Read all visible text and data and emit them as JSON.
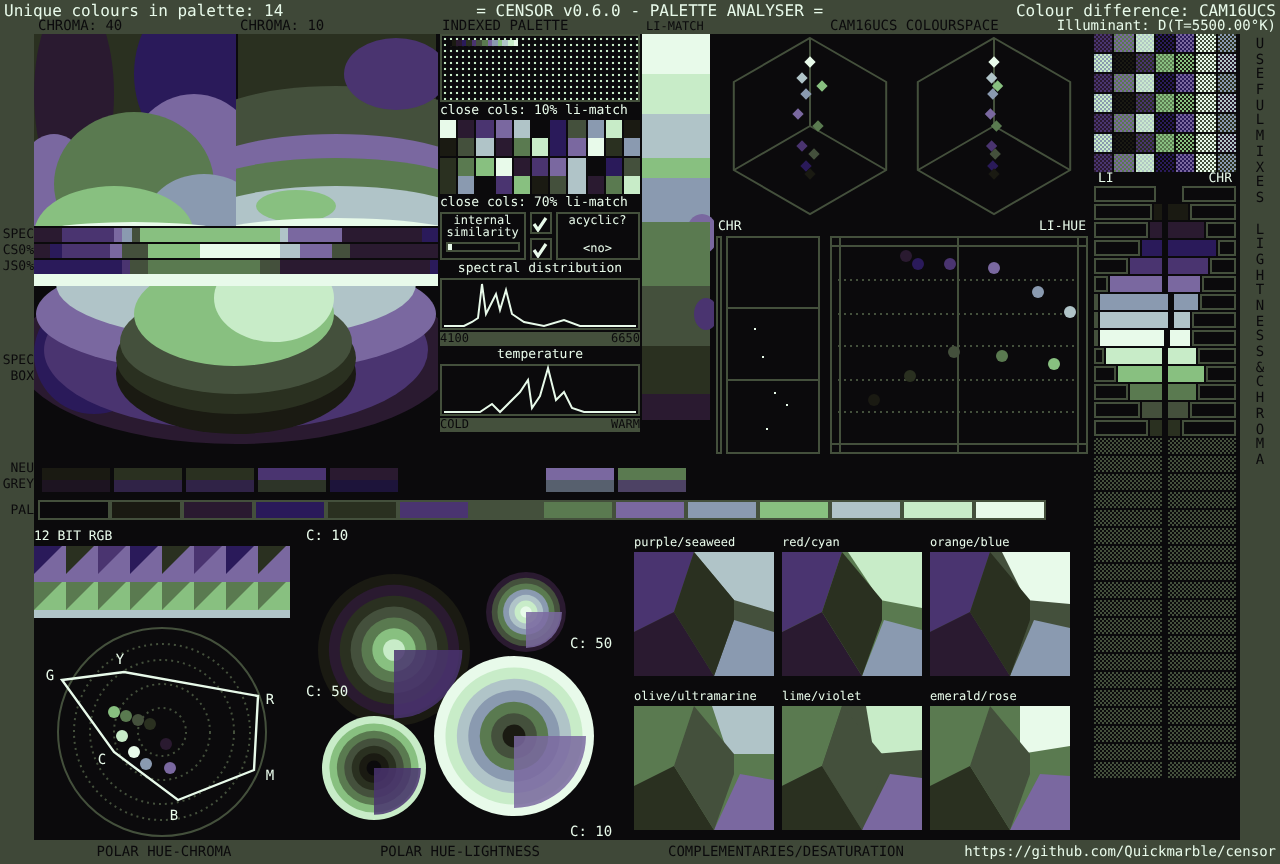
{
  "header": {
    "unique_colours": "Unique colours in palette: 14",
    "title": "= CENSOR v0.6.0 - PALETTE ANALYSER =",
    "colour_difference": "Colour difference: CAM16UCS",
    "illuminant": "Illuminant: D(T=5500.00°K)"
  },
  "panel_labels": {
    "chroma_40": "CHROMA: 40",
    "chroma_10": "CHROMA: 10",
    "indexed_palette": "INDEXED PALETTE",
    "li_match": "LI-MATCH",
    "colourspace": "CAM16UCS COLOURSPACE"
  },
  "side_labels": {
    "strips": [
      "SPEC",
      "CS0%",
      "JS0%"
    ],
    "spec_box": "SPEC BOX",
    "neutral_grey": "NEU GREY",
    "palette": "PAL"
  },
  "close_colours": [
    "close cols: 10% li-match",
    "close cols: 70% li-match"
  ],
  "internal_similarity": {
    "label": "internal similarity",
    "checked": true,
    "level": 0.05
  },
  "acyclic": {
    "label": "acyclic?",
    "checked": true,
    "value": "<no>"
  },
  "spectral": {
    "title": "spectral distribution",
    "min": "4100",
    "max": "6650"
  },
  "temperature": {
    "title": "temperature",
    "min": "COLD",
    "max": "WARM"
  },
  "li_hue": {
    "chr_label": "CHR",
    "title": "LI-HUE"
  },
  "bars": {
    "li_label": "LI",
    "chr_label": "CHR"
  },
  "side_titles": [
    "USEFUL MIXES",
    "LIGHTNESS & CHROMA"
  ],
  "rgb_label": "12 BIT RGB",
  "polar_chroma_hues": [
    "G",
    "Y",
    "R",
    "C",
    "M",
    "B"
  ],
  "polar_lightness": [
    "C: 10",
    "C: 50",
    "C: 50",
    "C: 10"
  ],
  "complementaries": [
    "purple/seaweed",
    "red/cyan",
    "orange/blue",
    "olive/ultramarine",
    "lime/violet",
    "emerald/rose"
  ],
  "footer": {
    "polar_hue_chroma": "POLAR HUE-CHROMA",
    "polar_hue_lightness": "POLAR HUE-LIGHTNESS",
    "complementaries": "COMPLEMENTARIES/DESATURATION",
    "url": "https://github.com/Quickmarble/censor"
  },
  "palette": [
    {
      "color": "#0b0a0c"
    },
    {
      "color": "#1a1a12"
    },
    {
      "color": "#2a1a30"
    },
    {
      "color": "#2a1a5a"
    },
    {
      "color": "#2a3020"
    },
    {
      "color": "#4a3470"
    },
    {
      "color": "#44503c"
    },
    {
      "color": "#5a7a50"
    },
    {
      "color": "#7a68a0"
    },
    {
      "color": "#8a9ab0"
    },
    {
      "color": "#88c080"
    },
    {
      "color": "#b0c4c8"
    },
    {
      "color": "#c8ecc8"
    },
    {
      "color": "#e8faea"
    }
  ]
}
